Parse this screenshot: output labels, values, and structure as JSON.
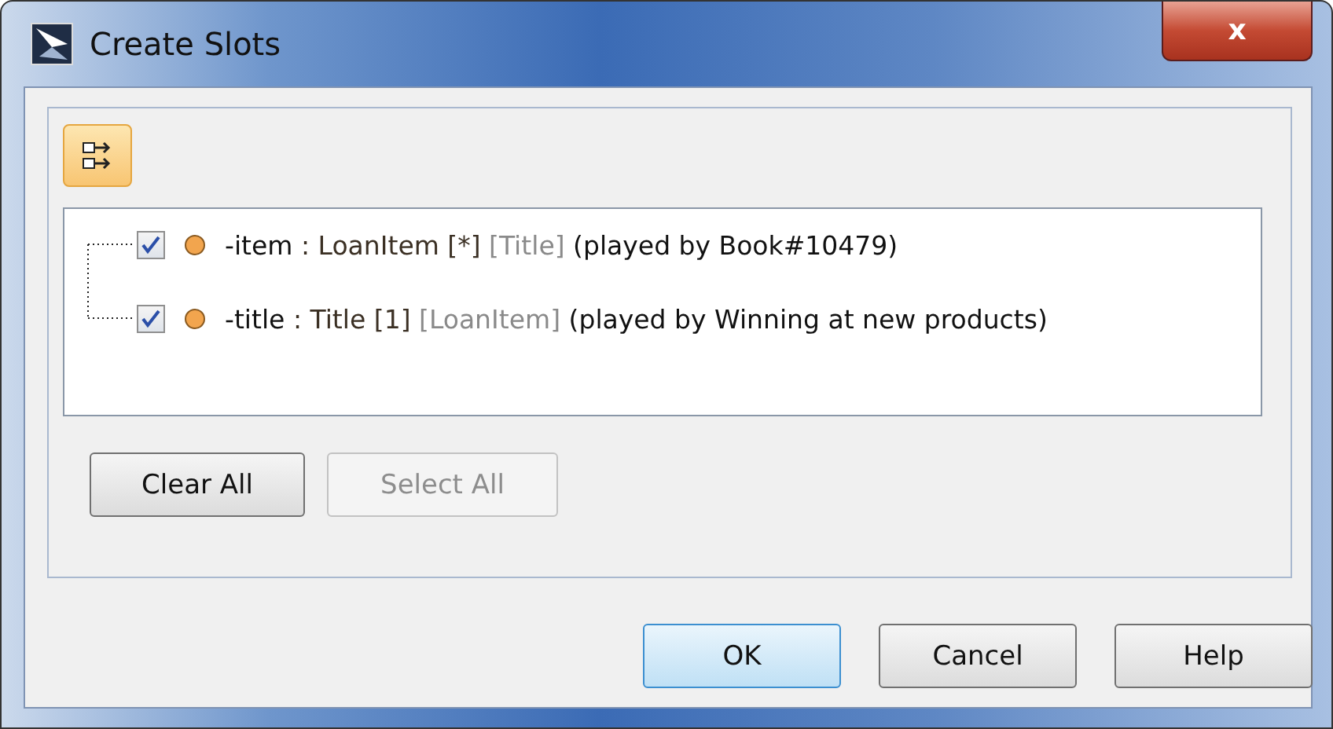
{
  "window": {
    "title": "Create Slots",
    "close_label": "x"
  },
  "toolbar": {
    "pressed": true
  },
  "slots": [
    {
      "name": "-item",
      "type": ": LoanItem [*]",
      "end": "[Title]",
      "played_by": "(played by Book#10479)",
      "checked": true
    },
    {
      "name": "-title",
      "type": ": Title [1]",
      "end": "[LoanItem]",
      "played_by": "(played by Winning at new products)",
      "checked": true
    }
  ],
  "list_buttons": [
    {
      "label": "Clear All",
      "disabled": false
    },
    {
      "label": "Select All",
      "disabled": true
    }
  ],
  "buttons": [
    {
      "label": "OK",
      "default": true
    },
    {
      "label": "Cancel",
      "default": false
    },
    {
      "label": "Help",
      "default": false
    }
  ]
}
